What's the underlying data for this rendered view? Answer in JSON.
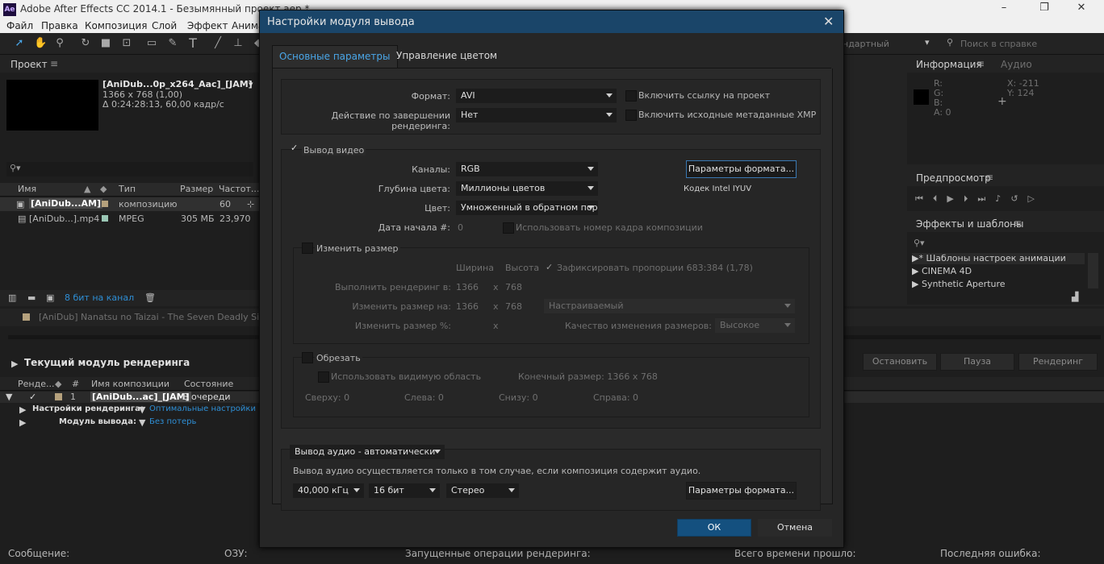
{
  "window": {
    "logo": "Ae",
    "title": "Adobe After Effects CC 2014.1 - Безымянный проект.aep *",
    "controls": [
      "–",
      "❐",
      "✕"
    ]
  },
  "menu": [
    "Файл",
    "Правка",
    "Композиция",
    "Слой",
    "Эффект",
    "Анима"
  ],
  "toolbar": {
    "workspace": "ндартный",
    "search_placeholder": "Поиск в справке"
  },
  "project": {
    "tab": "Проект",
    "comp_name": "[AniDub...0p_x264_Aac]_[JAM]",
    "comp_size": "1366 x 768 (1,00)",
    "comp_duration": "Δ 0:24:28:13, 60,00 кадр/с",
    "columns": [
      "Имя",
      "Тип",
      "Размер",
      "Частот..."
    ],
    "items": [
      {
        "name": "[AniDub...AM]",
        "type": "композицию",
        "size": "",
        "rate": "60"
      },
      {
        "name": "[AniDub...].mp4",
        "type": "MPEG",
        "size": "305 МБ",
        "rate": "23,970"
      }
    ],
    "bits": "8 бит на канал"
  },
  "info": {
    "tab": "Информация",
    "tab2": "Аудио",
    "r": "R:",
    "g": "G:",
    "b": "B:",
    "a": "A:  0",
    "x": "X:  -211",
    "y": "Y:  124"
  },
  "preview": {
    "tab": "Предпросмотр"
  },
  "effects": {
    "tab": "Эффекты и шаблоны",
    "items": [
      "* Шаблоны настроек анимации",
      "CINEMA 4D",
      "Synthetic Aperture"
    ]
  },
  "timeline": {
    "comp_tab": "[AniDub] Nanatsu no Taizai - The Seven Deadly Sins",
    "render_title": "Текущий модуль рендеринга",
    "stop": "Остановить",
    "pause": "Пауза",
    "render": "Рендеринг",
    "columns": [
      "Ренде...",
      "#",
      "Имя композиции",
      "Состояние"
    ],
    "row": {
      "num": "1",
      "name": "[AniDub...ac]_[JAM]",
      "state": "В очереди"
    },
    "settings_label": "Настройки рендеринга:",
    "settings_value": "Оптимальные настройки",
    "output_label": "Модуль вывода:",
    "output_value": "Без потерь"
  },
  "status": {
    "message": "Сообщение:",
    "ram": "ОЗУ:",
    "renders": "Запущенные операции рендеринга:",
    "elapsed": "Всего времени прошло:",
    "error": "Последняя ошибка:"
  },
  "dialog": {
    "title": "Настройки модуля вывода",
    "close": "✕",
    "tabs": [
      "Основные параметры",
      "Управление цветом"
    ],
    "format_label": "Формат:",
    "format_value": "AVI",
    "action_label": "Действие по завершении рендеринга:",
    "action_value": "Нет",
    "include_link": "Включить ссылку на проект",
    "include_xmp": "Включить исходные метаданные XMP",
    "video_output": "Вывод видео",
    "channels_label": "Каналы:",
    "channels_value": "RGB",
    "depth_label": "Глубина цвета:",
    "depth_value": "Миллионы цветов",
    "color_label": "Цвет:",
    "color_value": "Умноженный в обратном поряд",
    "start_label": "Дата начала #:",
    "start_value": "0",
    "use_comp_frame": "Использовать номер кадра композиции",
    "format_options": "Параметры формата...",
    "codec": "Кодек Intel IYUV",
    "resize": "Изменить размер",
    "width_h": "Ширина",
    "height_h": "Высота",
    "lock_aspect": "Зафиксировать пропорции 683:384 (1,78)",
    "render_at_label": "Выполнить рендеринг в:",
    "render_at_w": "1366",
    "render_at_h": "768",
    "resize_to_label": "Изменить размер на:",
    "resize_to_w": "1366",
    "resize_to_h": "768",
    "resize_custom": "Настраиваемый",
    "resize_pct_label": "Изменить размер %:",
    "x_sep": "x",
    "quality_label": "Качество изменения размеров:",
    "quality_value": "Высокое",
    "crop": "Обрезать",
    "use_roi": "Использовать видимую область",
    "final_size": "Конечный размер: 1366 x 768",
    "top": "Сверху:  0",
    "left": "Слева:  0",
    "bottom": "Снизу:  0",
    "right": "Справа:  0",
    "audio_output": "Вывод аудио - автоматически",
    "audio_note": "Вывод аудио осуществляется только в том случае, если композиция содержит аудио.",
    "rate": "40,000 кГц",
    "bits": "16 бит",
    "channels": "Стерео",
    "audio_format_options": "Параметры формата...",
    "ok": "ОК",
    "cancel": "Отмена"
  }
}
